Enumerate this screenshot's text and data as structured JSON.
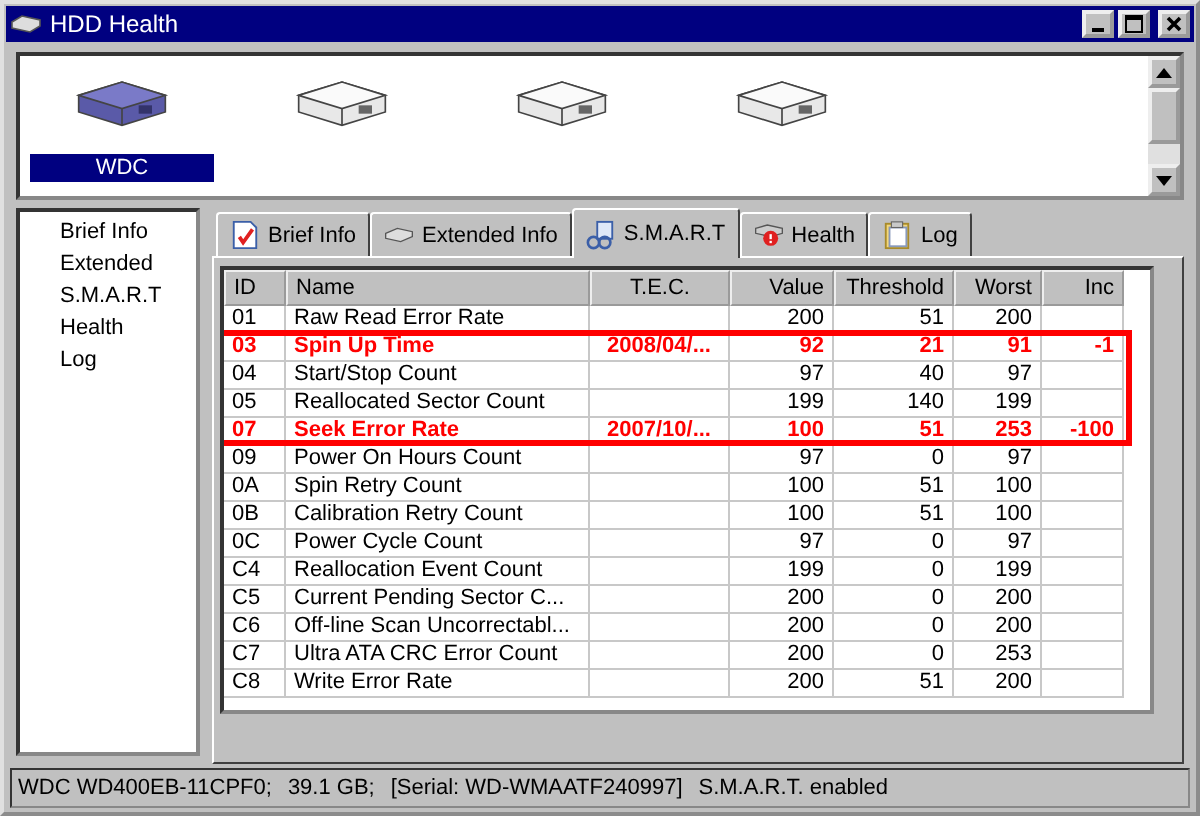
{
  "window": {
    "title": "HDD Health"
  },
  "drives": [
    {
      "label": "WDC",
      "selected": true
    },
    {
      "selected": false
    },
    {
      "selected": false
    },
    {
      "selected": false
    }
  ],
  "sidebar": {
    "items": [
      "Brief Info",
      "Extended",
      "S.M.A.R.T",
      "Health",
      "Log"
    ]
  },
  "tabs": [
    {
      "label": "Brief Info",
      "selected": false
    },
    {
      "label": "Extended Info",
      "selected": false
    },
    {
      "label": "S.M.A.R.T",
      "selected": true
    },
    {
      "label": "Health",
      "selected": false
    },
    {
      "label": "Log",
      "selected": false
    }
  ],
  "table": {
    "columns": [
      "ID",
      "Name",
      "T.E.C.",
      "Value",
      "Threshold",
      "Worst",
      "Inc"
    ],
    "rows": [
      {
        "id": "01",
        "name": "Raw Read Error Rate",
        "tec": "",
        "value": "200",
        "threshold": "51",
        "worst": "200",
        "inc": "",
        "alert": false,
        "boxed": false
      },
      {
        "id": "03",
        "name": "Spin Up Time",
        "tec": "2008/04/...",
        "value": "92",
        "threshold": "21",
        "worst": "91",
        "inc": "-1",
        "alert": true,
        "boxed": true
      },
      {
        "id": "04",
        "name": "Start/Stop Count",
        "tec": "",
        "value": "97",
        "threshold": "40",
        "worst": "97",
        "inc": "",
        "alert": false,
        "boxed": true
      },
      {
        "id": "05",
        "name": "Reallocated Sector Count",
        "tec": "",
        "value": "199",
        "threshold": "140",
        "worst": "199",
        "inc": "",
        "alert": false,
        "boxed": true
      },
      {
        "id": "07",
        "name": "Seek Error Rate",
        "tec": "2007/10/...",
        "value": "100",
        "threshold": "51",
        "worst": "253",
        "inc": "-100",
        "alert": true,
        "boxed": true
      },
      {
        "id": "09",
        "name": "Power On Hours Count",
        "tec": "",
        "value": "97",
        "threshold": "0",
        "worst": "97",
        "inc": "",
        "alert": false,
        "boxed": false
      },
      {
        "id": "0A",
        "name": "Spin Retry Count",
        "tec": "",
        "value": "100",
        "threshold": "51",
        "worst": "100",
        "inc": "",
        "alert": false,
        "boxed": false
      },
      {
        "id": "0B",
        "name": "Calibration Retry Count",
        "tec": "",
        "value": "100",
        "threshold": "51",
        "worst": "100",
        "inc": "",
        "alert": false,
        "boxed": false
      },
      {
        "id": "0C",
        "name": "Power Cycle Count",
        "tec": "",
        "value": "97",
        "threshold": "0",
        "worst": "97",
        "inc": "",
        "alert": false,
        "boxed": false
      },
      {
        "id": "C4",
        "name": "Reallocation Event Count",
        "tec": "",
        "value": "199",
        "threshold": "0",
        "worst": "199",
        "inc": "",
        "alert": false,
        "boxed": false
      },
      {
        "id": "C5",
        "name": "Current Pending Sector C...",
        "tec": "",
        "value": "200",
        "threshold": "0",
        "worst": "200",
        "inc": "",
        "alert": false,
        "boxed": false
      },
      {
        "id": "C6",
        "name": "Off-line Scan Uncorrectabl...",
        "tec": "",
        "value": "200",
        "threshold": "0",
        "worst": "200",
        "inc": "",
        "alert": false,
        "boxed": false
      },
      {
        "id": "C7",
        "name": "Ultra ATA CRC Error Count",
        "tec": "",
        "value": "200",
        "threshold": "0",
        "worst": "253",
        "inc": "",
        "alert": false,
        "boxed": false
      },
      {
        "id": "C8",
        "name": "Write Error Rate",
        "tec": "",
        "value": "200",
        "threshold": "51",
        "worst": "200",
        "inc": "",
        "alert": false,
        "boxed": false
      }
    ]
  },
  "status_bar": [
    "WDC WD400EB-11CPF0;",
    "39.1 GB;",
    "[Serial: WD-WMAATF240997]",
    "S.M.A.R.T. enabled"
  ]
}
